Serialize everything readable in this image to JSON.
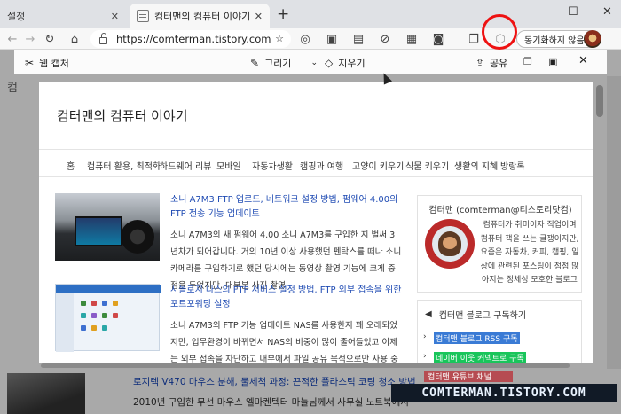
{
  "browser": {
    "tabs": [
      {
        "label": "설정"
      },
      {
        "label": "컴터맨의 컴퓨터 이야기"
      }
    ],
    "address": "https://comterman.tistory.com",
    "sync_label": "동기화하지 않음"
  },
  "capture": {
    "title": "웹 캡처",
    "draw_label": "그리기",
    "erase_label": "지우기",
    "share_label": "공유"
  },
  "page": {
    "blog_title": "컴터맨의 컴퓨터 이야기",
    "nav": [
      "홈",
      "컴퓨터 활용, 최적화",
      "하드웨어 리뷰",
      "모바일",
      "자동차생활",
      "캠핑과 여행",
      "고양이 키우기",
      "식물 키우기",
      "생활의 지혜",
      "방랑록"
    ],
    "posts": [
      {
        "title": "소니 A7M3 FTP 업로드, 네트워크 설정 방법, 펌웨어 4.00의 FTP 전송 기능 업데이트",
        "body": "소니 A7M3의 새 펌웨어 4.00 소니 A7M3를 구입한 지 벌써 3년차가 되어갑니다. 거의 10년 이상 사용했던 펜탁스를 떠나 소니 카메라를 구입하기로 했던 당시에는 동영상 촬영 기능에 크게 중점을 두었지만, 대부분 사진 촬영"
      },
      {
        "title": "시놀로지 나스의 FTP 서비스 설정 방법, FTP 외부 접속을 위한 포트포워딩 설정",
        "body": "소니 A7M3의 FTP 기능 업데이트 NAS를 사용한지 꽤 오래되었지만, 업무환경이 바뀌면서 NAS의 비중이 많이 줄어들었고 이제는 외부 접속을 차단하고 내부에서 파일 공유 목적으로만 사용 중입니다. 약 1년 전 지인이 사용"
      }
    ],
    "profile": {
      "name": "컴터맨 (comterman@티스토리닷컴)",
      "desc": "컴퓨터가 취미이자 직업이며 컴퓨터 책을 쓰는 글쟁이지만, 요즘은 자동차, 커피, 캠핑, 일상에 관련된 포스팅이 점점 많아지는 정체성 모호한 블로그"
    },
    "subscribe": {
      "title": "컴터맨 블로그 구독하기",
      "links": [
        {
          "label": "컴터맨 블로그 RSS 구독",
          "color": "#3a7bd5"
        },
        {
          "label": "네이버 이웃 커넥트로 구독",
          "color": "#19c55b"
        }
      ]
    }
  },
  "background": {
    "line1": "로지텍 V470 마우스 분해, 물세척 과정: 끈적한 플라스틱 코팅 청소 방법",
    "line2": "2010년 구입한 무선 마우스 엘마켄텍터 마늘님께서 사무실 노트북에서",
    "badge": "컴터맨 유튜브 채널",
    "left_char": "컴"
  },
  "watermark": "COMTERMAN.TISTORY.COM",
  "colors": {
    "accent_link": "#1f4bb3",
    "highlight_red": "#ee1111",
    "rss_link": "#3a7bd5",
    "naver_link": "#19c55b"
  }
}
